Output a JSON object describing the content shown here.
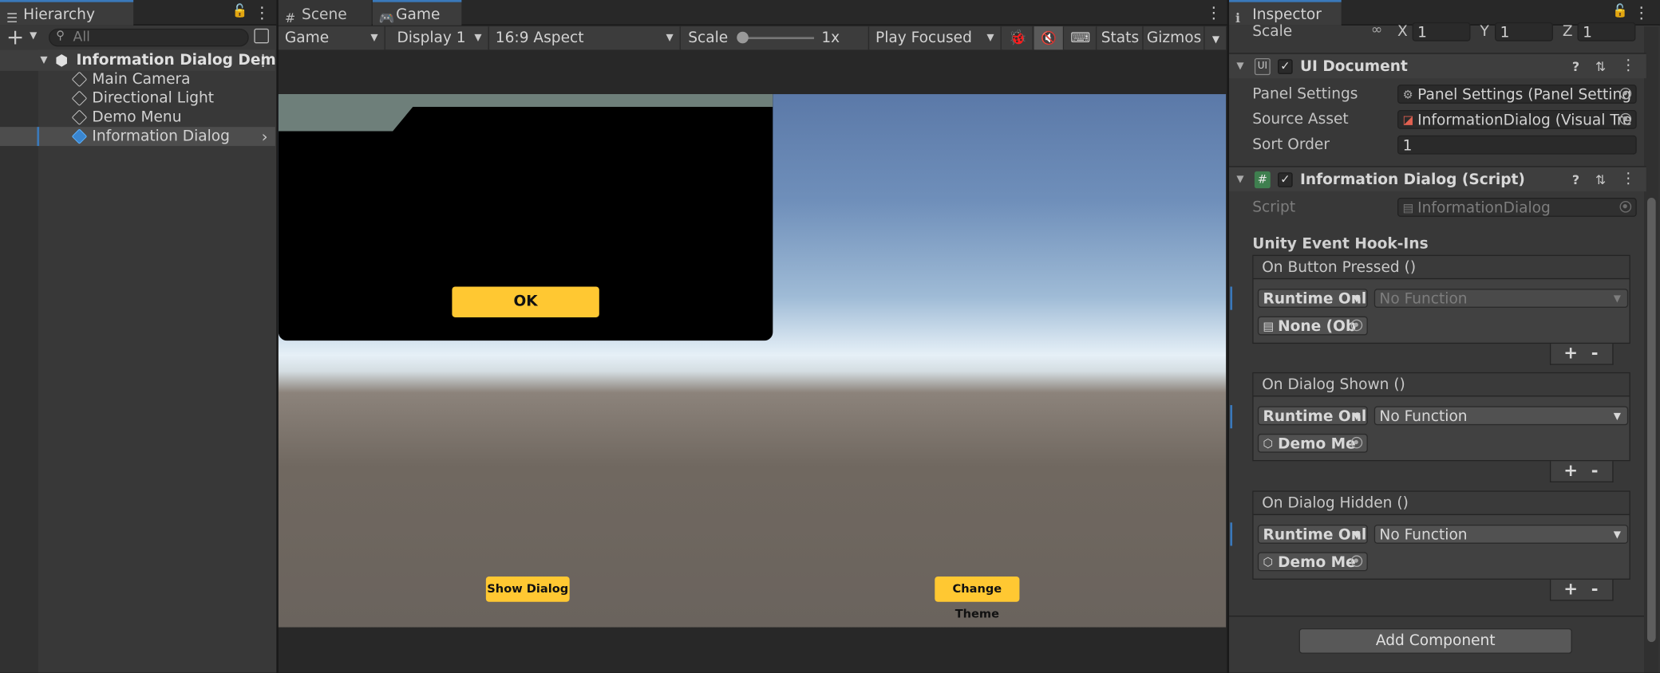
{
  "hierarchy": {
    "tab_label": "Hierarchy",
    "search_placeholder": "All",
    "scene_name": "Information Dialog Dem",
    "items": [
      {
        "label": "Main Camera"
      },
      {
        "label": "Directional Light"
      },
      {
        "label": "Demo Menu"
      },
      {
        "label": "Information Dialog"
      }
    ]
  },
  "center": {
    "tabs": [
      {
        "label": "Scene"
      },
      {
        "label": "Game"
      }
    ],
    "toolbar": {
      "game_dd": "Game",
      "display_dd": "Display 1",
      "aspect_dd": "16:9 Aspect",
      "scale_label": "Scale",
      "scale_value": "1x",
      "play_dd": "Play Focused",
      "stats": "Stats",
      "gizmos": "Gizmos"
    },
    "game": {
      "ok_label": "OK",
      "show_dialog_label": "Show Dialog",
      "change_theme_label": "Change Theme"
    }
  },
  "inspector": {
    "tab_label": "Inspector",
    "scale": {
      "label": "Scale",
      "x_label": "X",
      "x": "1",
      "y_label": "Y",
      "y": "1",
      "z_label": "Z",
      "z": "1"
    },
    "ui_document": {
      "title": "UI Document",
      "panel_settings_label": "Panel Settings",
      "panel_settings_value": "Panel Settings (Panel Setting",
      "source_asset_label": "Source Asset",
      "source_asset_value": "InformationDialog (Visual Tre",
      "sort_order_label": "Sort Order",
      "sort_order_value": "1"
    },
    "script_comp": {
      "title": "Information Dialog (Script)",
      "script_label": "Script",
      "script_value": "InformationDialog",
      "section_title": "Unity Event Hook-Ins",
      "events": [
        {
          "header": "On Button Pressed ()",
          "mode": "Runtime Onl",
          "function": "No Function",
          "object": "None (Ob"
        },
        {
          "header": "On Dialog Shown ()",
          "mode": "Runtime Onl",
          "function": "No Function",
          "object": "Demo Me"
        },
        {
          "header": "On Dialog Hidden ()",
          "mode": "Runtime Onl",
          "function": "No Function",
          "object": "Demo Me"
        }
      ]
    },
    "add_component_label": "Add Component"
  },
  "icons": {
    "plus": "+",
    "minus": "-",
    "kebab": "⋮",
    "lock": "🔓",
    "check": "✓",
    "help": "?",
    "settings": "⇅",
    "arrow_down": "▼",
    "arrow_right": "›"
  },
  "colors": {
    "accent": "#3a79bb",
    "dialog_button": "#ffc832",
    "panel_bg": "#383838",
    "toolbar_bg": "#282828"
  }
}
